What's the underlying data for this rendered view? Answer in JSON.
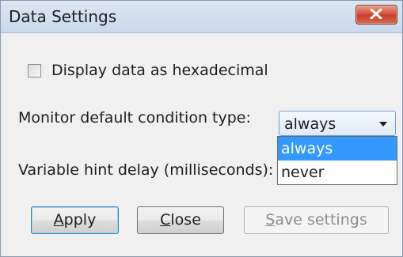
{
  "dialog": {
    "title": "Data Settings"
  },
  "options": {
    "hex_checkbox_label": "Display data as hexadecimal",
    "hex_checked": false,
    "monitor_label": "Monitor default condition type:",
    "monitor_selected": "always",
    "monitor_options": [
      "always",
      "never"
    ],
    "hint_delay_label": "Variable hint delay (milliseconds):"
  },
  "buttons": {
    "apply_mnemonic": "A",
    "apply_rest": "pply",
    "close_mnemonic": "C",
    "close_rest": "lose",
    "save_mnemonic": "S",
    "save_rest": "ave settings"
  },
  "icons": {
    "title_close": "close-icon",
    "dropdown": "chevron-down-icon"
  },
  "colors": {
    "selection": "#3399ff",
    "close_button": "#c4402a"
  }
}
